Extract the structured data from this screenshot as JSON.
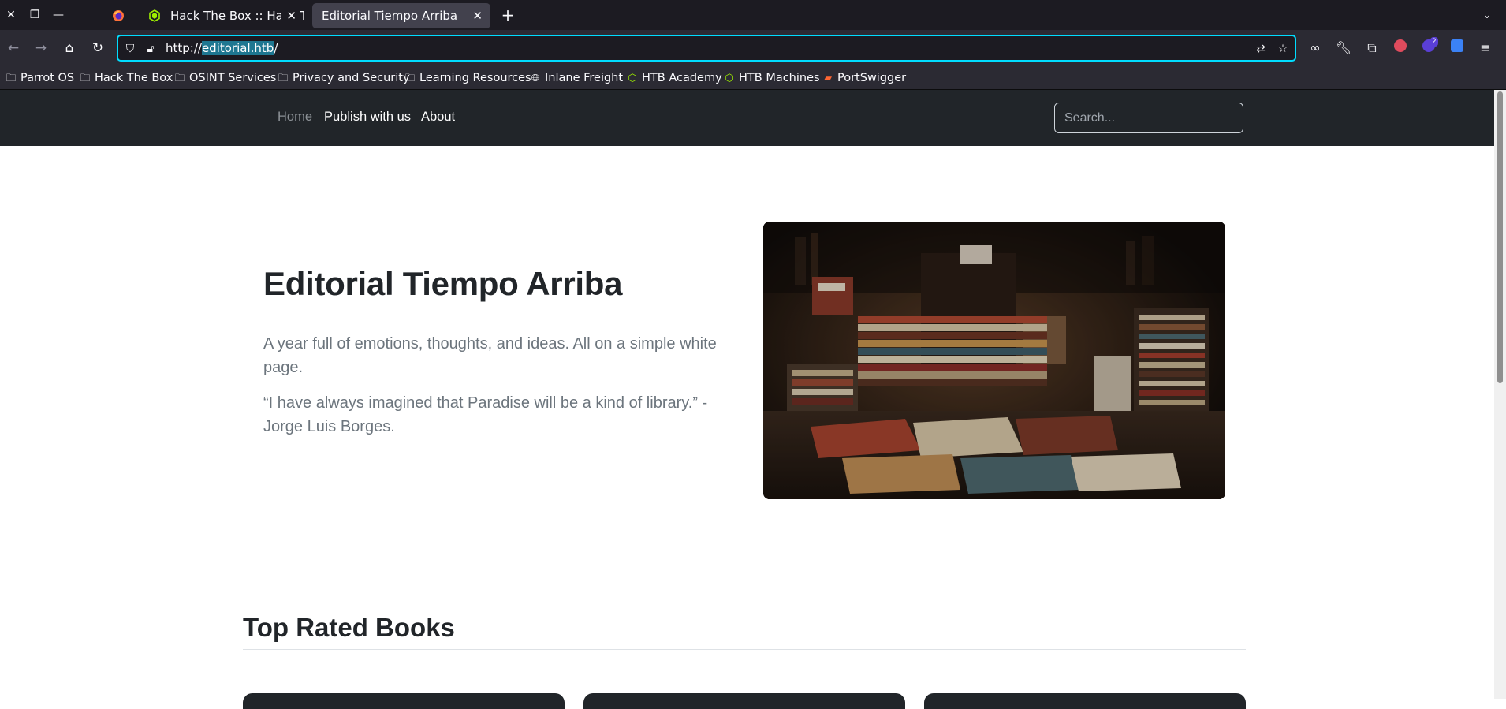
{
  "browser": {
    "tabs": [
      {
        "title": "Hack The Box :: Hack The Box",
        "icon": "hackthebox-icon"
      },
      {
        "title": "Editorial Tiempo Arriba",
        "icon": null
      }
    ],
    "url": {
      "scheme": "http://",
      "host": "editorial.htb",
      "path": "/"
    },
    "bookmarks": [
      {
        "label": "Parrot OS",
        "icon": "folder-icon"
      },
      {
        "label": "Hack The Box",
        "icon": "folder-icon"
      },
      {
        "label": "OSINT Services",
        "icon": "folder-icon"
      },
      {
        "label": "Privacy and Security",
        "icon": "folder-icon"
      },
      {
        "label": "Learning Resources",
        "icon": "folder-icon"
      },
      {
        "label": "Inlane Freight",
        "icon": "globe-icon"
      },
      {
        "label": "HTB Academy",
        "icon": "hackthebox-icon"
      },
      {
        "label": "HTB Machines",
        "icon": "hackthebox-icon"
      },
      {
        "label": "PortSwigger",
        "icon": "portswigger-icon"
      }
    ],
    "extension_badge": "2",
    "colors": {
      "focus_ring": "#00ddff",
      "chrome_dark": "#1c1b22",
      "toolbar": "#2b2a33"
    }
  },
  "site": {
    "nav": {
      "home": "Home",
      "publish": "Publish with us",
      "about": "About",
      "search_placeholder": "Search..."
    },
    "hero": {
      "title": "Editorial Tiempo Arriba",
      "lead": "A year full of emotions, thoughts, and ideas. All on a simple white page.",
      "quote": "“I have always imagined that Paradise will be a kind of library.” - Jorge Luis Borges."
    },
    "section_title": "Top Rated Books",
    "colors": {
      "navbar": "#212529",
      "text": "#212529",
      "muted": "#6c757d"
    }
  }
}
